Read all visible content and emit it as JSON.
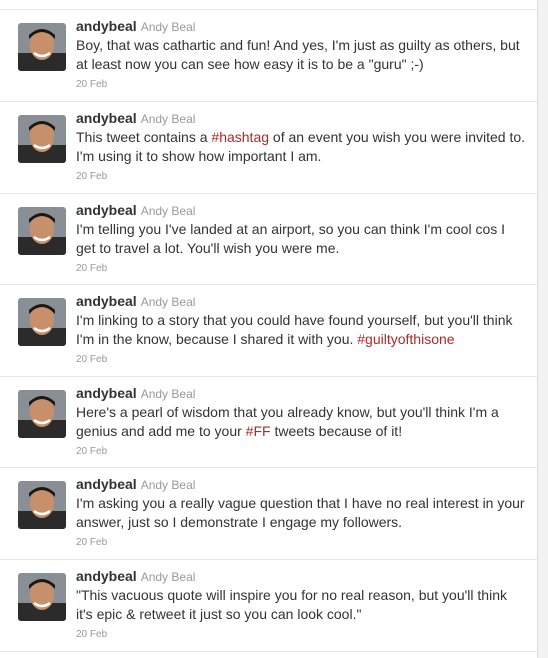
{
  "colors": {
    "hashtag": "#b02727",
    "text": "#333333",
    "muted": "#999999"
  },
  "tweets": [
    {
      "screen_name": "andybeal",
      "full_name": "Andy Beal",
      "text_parts": [
        "Boy, that was cathartic and fun! And yes, I'm just as guilty as others, but at least now you can see how easy it is to be a \"guru\" ;-)",
        "",
        ""
      ],
      "hashtag": "",
      "time": "20 Feb"
    },
    {
      "screen_name": "andybeal",
      "full_name": "Andy Beal",
      "text_parts": [
        "This tweet contains a ",
        "#hashtag",
        " of an event you wish you were invited to. I'm using it to show how important I am."
      ],
      "time": "20 Feb"
    },
    {
      "screen_name": "andybeal",
      "full_name": "Andy Beal",
      "text_parts": [
        "I'm telling you I've landed at an airport, so you can think I'm cool cos I get to travel a lot. You'll wish you were me.",
        "",
        ""
      ],
      "time": "20 Feb"
    },
    {
      "screen_name": "andybeal",
      "full_name": "Andy Beal",
      "text_parts": [
        "I'm linking to a story that you could have found yourself, but you'll think I'm in the know, because I shared it with you. ",
        "#guiltyofthisone",
        ""
      ],
      "time": "20 Feb"
    },
    {
      "screen_name": "andybeal",
      "full_name": "Andy Beal",
      "text_parts": [
        "Here's a pearl of wisdom that you already know, but you'll think I'm a genius and add me to your ",
        "#FF",
        " tweets because of it!"
      ],
      "time": "20 Feb"
    },
    {
      "screen_name": "andybeal",
      "full_name": "Andy Beal",
      "text_parts": [
        "I'm asking you a really vague question that I have no real interest in your answer, just so I demonstrate I engage my followers.",
        "",
        ""
      ],
      "time": "20 Feb"
    },
    {
      "screen_name": "andybeal",
      "full_name": "Andy Beal",
      "text_parts": [
        "\"This vacuous quote will inspire you for no real reason, but you'll think it's epic & retweet it just so you can look cool.\"",
        "",
        ""
      ],
      "time": "20 Feb"
    }
  ]
}
